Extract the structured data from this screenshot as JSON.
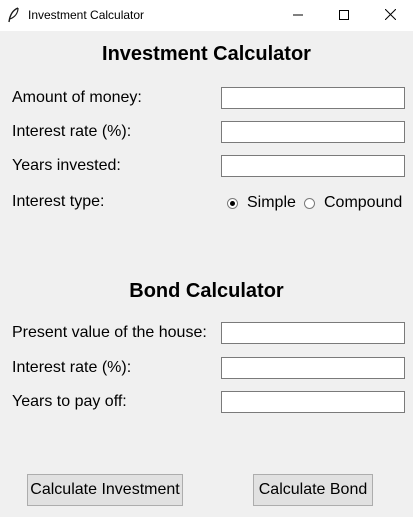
{
  "window": {
    "title": "Investment Calculator"
  },
  "investment": {
    "heading": "Investment Calculator",
    "amount_label": "Amount of money:",
    "amount_value": "",
    "rate_label": "Interest rate (%):",
    "rate_value": "",
    "years_label": "Years invested:",
    "years_value": "",
    "type_label": "Interest type:",
    "options": [
      "Simple",
      "Compound"
    ],
    "selected": "Simple"
  },
  "bond": {
    "heading": "Bond Calculator",
    "present_value_label": "Present value of the house:",
    "present_value_value": "",
    "rate_label": "Interest rate (%):",
    "rate_value": "",
    "years_label": "Years to pay off:",
    "years_value": ""
  },
  "buttons": {
    "calculate_investment": "Calculate Investment",
    "calculate_bond": "Calculate Bond"
  },
  "icons": {
    "app": "feather-icon",
    "minimize": "minimize-icon",
    "maximize": "maximize-icon",
    "close": "close-icon"
  }
}
